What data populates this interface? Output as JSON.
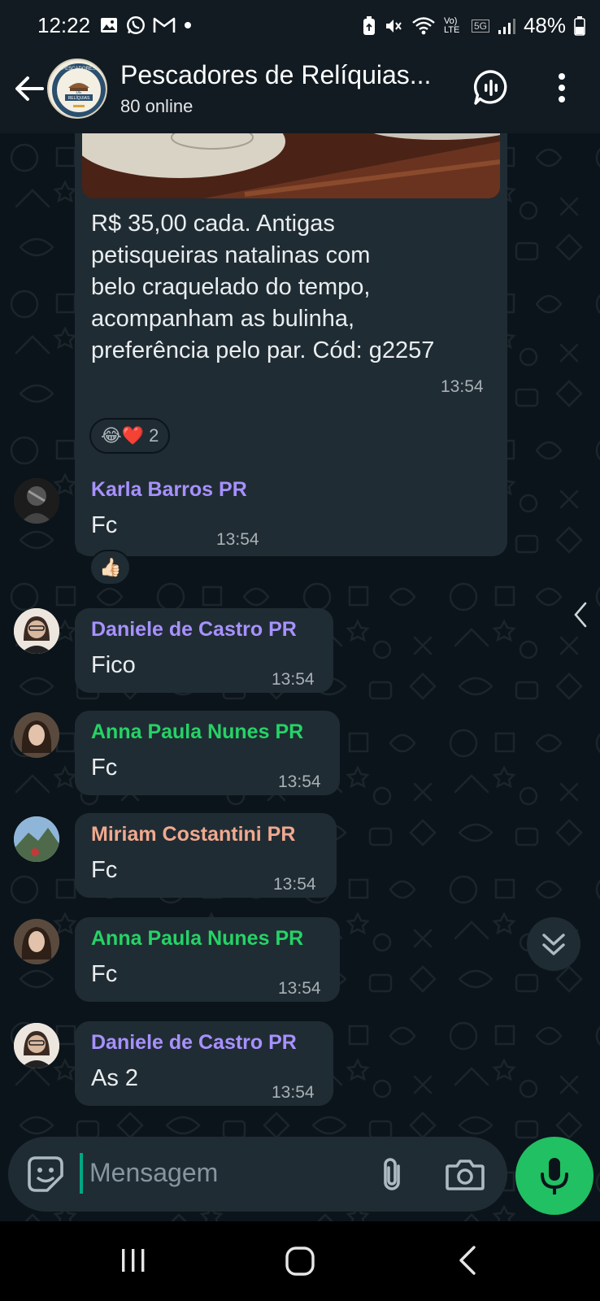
{
  "status_bar": {
    "time": "12:22",
    "network": "5G",
    "volte": "Vo) LTE",
    "battery": "48%",
    "icons": [
      "gallery-icon",
      "whatsapp-icon",
      "gmail-icon",
      "dot-icon",
      "lock-icon",
      "mute-icon",
      "wifi-icon",
      "signal-icon",
      "battery-icon"
    ]
  },
  "header": {
    "group_name": "Pescadores de Relíquias...",
    "subtitle": "80 online",
    "avatar_text_top": "PESCADORES",
    "avatar_text_mid": "DE",
    "avatar_text_bottom": "RELÍQUIAS"
  },
  "messages": [
    {
      "text_lines": [
        "R$ 35,00 cada. Antigas",
        "petisqueiras natalinas com",
        "belo craquelado do tempo,",
        "acompanham as bulinha,",
        "preferência pelo par. Cód: g2257"
      ],
      "time": "13:54",
      "reactions": {
        "emojis": "😂❤️",
        "count": "2"
      }
    },
    {
      "sender": "Karla Barros PR",
      "color": "#a791ff",
      "text": "Fc",
      "time": "13:54",
      "reaction": "👍🏻"
    },
    {
      "sender": "Daniele de Castro PR",
      "color": "#a791ff",
      "text": "Fico",
      "time": "13:54"
    },
    {
      "sender": "Anna Paula Nunes PR",
      "color": "#25d366",
      "text": "Fc",
      "time": "13:54"
    },
    {
      "sender": "Miriam Costantini PR",
      "color": "#f0a98f",
      "text": "Fc",
      "time": "13:54"
    },
    {
      "sender": "Anna Paula Nunes PR",
      "color": "#25d366",
      "text": "Fc",
      "time": "13:54"
    },
    {
      "sender": "Daniele de Castro PR",
      "color": "#a791ff",
      "text": "As 2",
      "time": "13:54"
    }
  ],
  "input": {
    "placeholder": "Mensagem"
  },
  "colors": {
    "accent": "#00a884",
    "mic": "#21c063",
    "bubble": "#202c33",
    "background": "#0b141a"
  }
}
